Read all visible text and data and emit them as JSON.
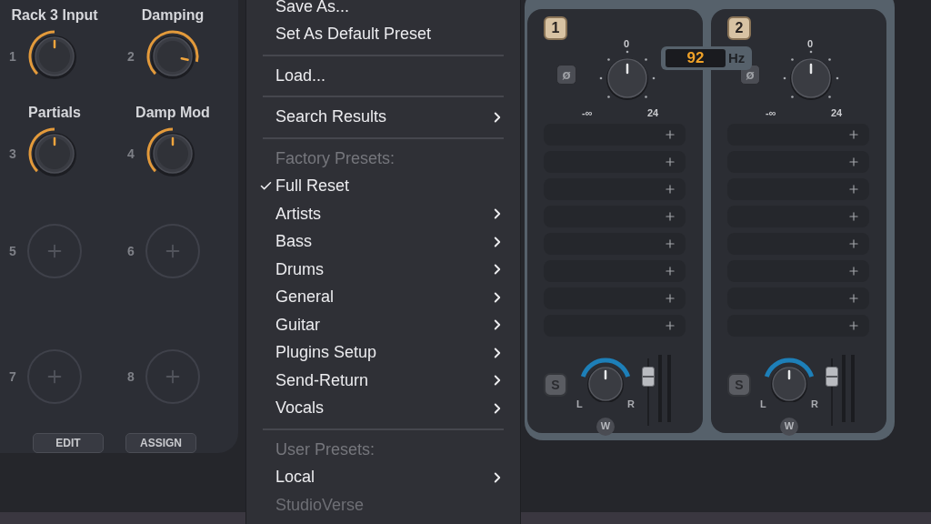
{
  "macro_panel": {
    "knobs": [
      {
        "number": "1",
        "label": "Rack 3 Input",
        "kind": "knob"
      },
      {
        "number": "2",
        "label": "Damping",
        "kind": "knob"
      },
      {
        "number": "3",
        "label": "Partials",
        "kind": "knob"
      },
      {
        "number": "4",
        "label": "Damp Mod",
        "kind": "knob"
      },
      {
        "number": "5",
        "kind": "empty"
      },
      {
        "number": "6",
        "kind": "empty"
      },
      {
        "number": "7",
        "kind": "empty"
      },
      {
        "number": "8",
        "kind": "empty"
      }
    ],
    "buttons": [
      "EDIT",
      "ASSIGN"
    ]
  },
  "preset_menu": {
    "items": [
      {
        "kind": "item",
        "label": "Save As...",
        "checked": false,
        "submenu": false,
        "disabled": false
      },
      {
        "kind": "item",
        "label": "Set As Default Preset",
        "checked": false,
        "submenu": false,
        "disabled": false
      },
      {
        "kind": "separator"
      },
      {
        "kind": "item",
        "label": "Load...",
        "checked": false,
        "submenu": false,
        "disabled": false
      },
      {
        "kind": "separator"
      },
      {
        "kind": "item",
        "label": "Search Results",
        "checked": false,
        "submenu": true,
        "disabled": false
      },
      {
        "kind": "separator"
      },
      {
        "kind": "header",
        "label": "Factory Presets:"
      },
      {
        "kind": "item",
        "label": "Full Reset",
        "checked": true,
        "submenu": false,
        "disabled": false
      },
      {
        "kind": "item",
        "label": "Artists",
        "checked": false,
        "submenu": true,
        "disabled": false
      },
      {
        "kind": "item",
        "label": "Bass",
        "checked": false,
        "submenu": true,
        "disabled": false
      },
      {
        "kind": "item",
        "label": "Drums",
        "checked": false,
        "submenu": true,
        "disabled": false
      },
      {
        "kind": "item",
        "label": "General",
        "checked": false,
        "submenu": true,
        "disabled": false
      },
      {
        "kind": "item",
        "label": "Guitar",
        "checked": false,
        "submenu": true,
        "disabled": false
      },
      {
        "kind": "item",
        "label": "Plugins Setup",
        "checked": false,
        "submenu": true,
        "disabled": false
      },
      {
        "kind": "item",
        "label": "Send-Return",
        "checked": false,
        "submenu": true,
        "disabled": false
      },
      {
        "kind": "item",
        "label": "Vocals",
        "checked": false,
        "submenu": true,
        "disabled": false
      },
      {
        "kind": "separator"
      },
      {
        "kind": "header",
        "label": "User Presets:"
      },
      {
        "kind": "item",
        "label": "Local",
        "checked": false,
        "submenu": true,
        "disabled": false
      },
      {
        "kind": "item",
        "label": "StudioVerse",
        "checked": false,
        "submenu": false,
        "disabled": true
      }
    ]
  },
  "rack": {
    "frequency": {
      "value": "92",
      "unit": "Hz"
    },
    "channels": [
      {
        "badge": "1",
        "phase": "ø",
        "gain": {
          "top_label": "0",
          "min_label": "-∞",
          "max_label": "24"
        },
        "slots": [
          {
            "kind": "empty"
          },
          {
            "kind": "empty"
          },
          {
            "kind": "empty"
          },
          {
            "kind": "empty"
          },
          {
            "kind": "empty"
          },
          {
            "kind": "empty"
          },
          {
            "kind": "empty"
          },
          {
            "kind": "empty"
          }
        ],
        "solo": "S",
        "pan": {
          "left": "L",
          "right": "R"
        },
        "width": "W"
      },
      {
        "badge": "2",
        "phase": "ø",
        "gain": {
          "top_label": "0",
          "min_label": "-∞",
          "max_label": "24"
        },
        "slots": [
          {
            "kind": "empty"
          },
          {
            "kind": "empty"
          },
          {
            "kind": "empty"
          },
          {
            "kind": "empty"
          },
          {
            "kind": "empty"
          },
          {
            "kind": "empty"
          },
          {
            "kind": "empty"
          },
          {
            "kind": "empty"
          }
        ],
        "solo": "S",
        "pan": {
          "left": "L",
          "right": "R"
        },
        "width": "W"
      }
    ]
  }
}
